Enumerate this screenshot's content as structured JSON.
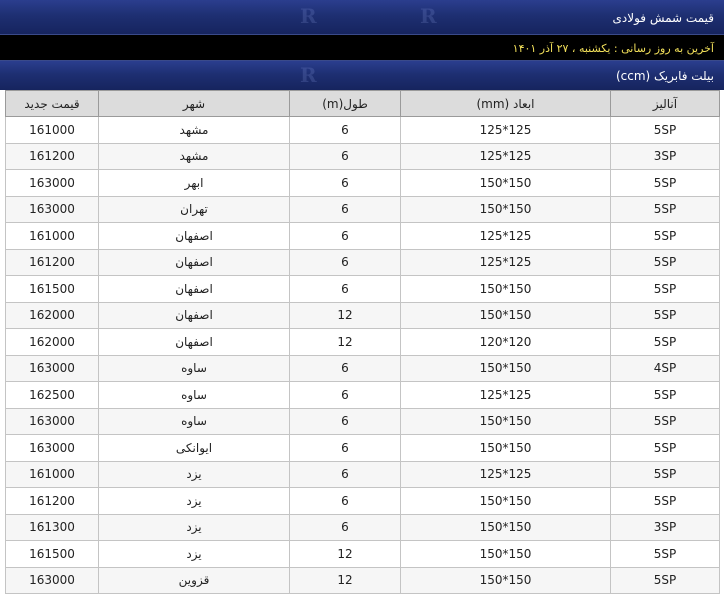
{
  "header": {
    "title": "قیمت شمش فولادی",
    "update_text": "آخرین به روز رسانی : یکشنبه ، ۲۷ آذر ۱۴۰۱",
    "section_title": "بیلت فابریک (ccm)"
  },
  "table": {
    "columns": [
      "آنالیز",
      "ابعاد (mm)",
      "طول(m)",
      "شهر",
      "قیمت جدید"
    ],
    "rows": [
      [
        "5SP",
        "125*125",
        "6",
        "مشهد",
        "161000"
      ],
      [
        "3SP",
        "125*125",
        "6",
        "مشهد",
        "161200"
      ],
      [
        "5SP",
        "150*150",
        "6",
        "ابهر",
        "163000"
      ],
      [
        "5SP",
        "150*150",
        "6",
        "تهران",
        "163000"
      ],
      [
        "5SP",
        "125*125",
        "6",
        "اصفهان",
        "161000"
      ],
      [
        "5SP",
        "125*125",
        "6",
        "اصفهان",
        "161200"
      ],
      [
        "5SP",
        "150*150",
        "6",
        "اصفهان",
        "161500"
      ],
      [
        "5SP",
        "150*150",
        "12",
        "اصفهان",
        "162000"
      ],
      [
        "5SP",
        "120*120",
        "12",
        "اصفهان",
        "162000"
      ],
      [
        "4SP",
        "150*150",
        "6",
        "ساوه",
        "163000"
      ],
      [
        "5SP",
        "125*125",
        "6",
        "ساوه",
        "162500"
      ],
      [
        "5SP",
        "150*150",
        "6",
        "ساوه",
        "163000"
      ],
      [
        "5SP",
        "150*150",
        "6",
        "ایوانکی",
        "163000"
      ],
      [
        "5SP",
        "125*125",
        "6",
        "یزد",
        "161000"
      ],
      [
        "5SP",
        "150*150",
        "6",
        "یزد",
        "161200"
      ],
      [
        "3SP",
        "150*150",
        "6",
        "یزد",
        "161300"
      ],
      [
        "5SP",
        "150*150",
        "12",
        "یزد",
        "161500"
      ],
      [
        "5SP",
        "150*150",
        "12",
        "قزوین",
        "163000"
      ]
    ]
  }
}
